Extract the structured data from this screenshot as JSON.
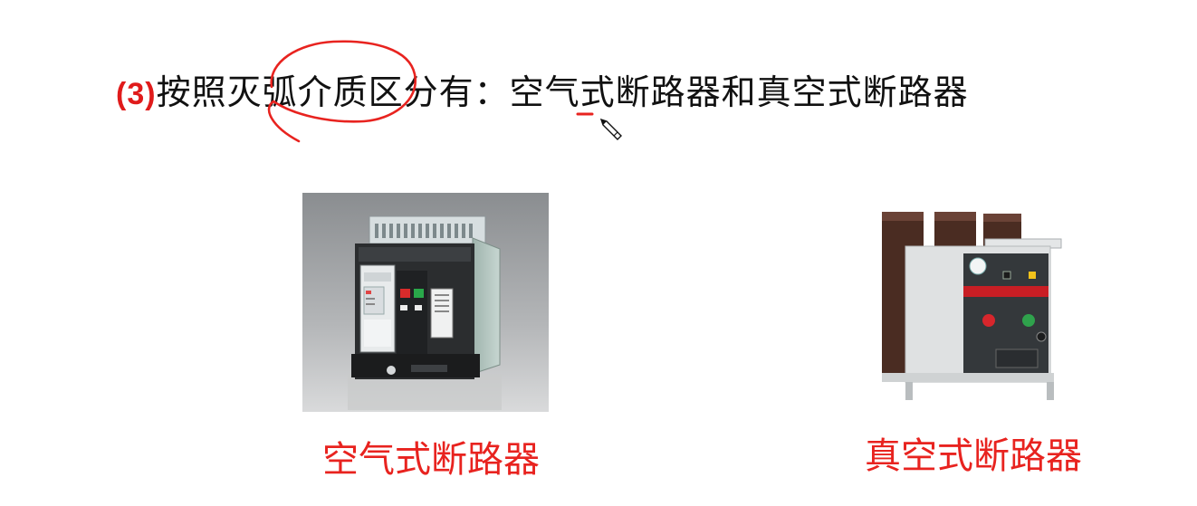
{
  "heading": {
    "number": "(3)",
    "text": "按照灭弧介质区分有：空气式断路器和真空式断路器"
  },
  "images": {
    "air_breaker": {
      "caption": "空气式断路器"
    },
    "vacuum_breaker": {
      "caption": "真空式断路器"
    }
  },
  "colors": {
    "accent_red": "#e8231f",
    "text": "#111111",
    "background": "#ffffff"
  },
  "icons": [
    "pencil-cursor-icon"
  ]
}
